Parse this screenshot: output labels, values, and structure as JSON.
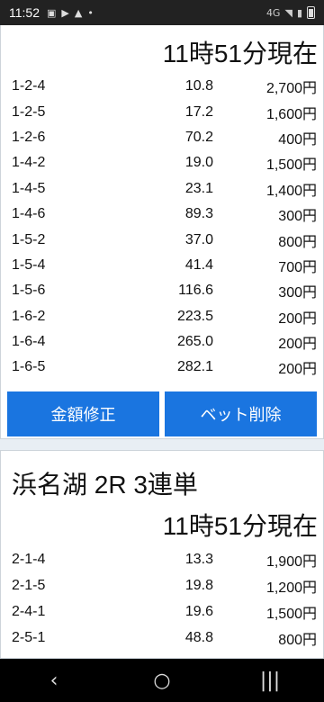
{
  "status_bar": {
    "time": "11:52",
    "icons": [
      "image-icon",
      "play-store-icon",
      "warning-icon",
      "dot-icon"
    ],
    "signal": "4G",
    "wifi_icon": "wifi-icon",
    "battery_icon": "battery-icon"
  },
  "card1": {
    "as_of": "11時51分現在",
    "rows": [
      {
        "combo": "1-2-4",
        "odds": "10.8",
        "amount": "2,700円"
      },
      {
        "combo": "1-2-5",
        "odds": "17.2",
        "amount": "1,600円"
      },
      {
        "combo": "1-2-6",
        "odds": "70.2",
        "amount": "400円"
      },
      {
        "combo": "1-4-2",
        "odds": "19.0",
        "amount": "1,500円"
      },
      {
        "combo": "1-4-5",
        "odds": "23.1",
        "amount": "1,400円"
      },
      {
        "combo": "1-4-6",
        "odds": "89.3",
        "amount": "300円"
      },
      {
        "combo": "1-5-2",
        "odds": "37.0",
        "amount": "800円"
      },
      {
        "combo": "1-5-4",
        "odds": "41.4",
        "amount": "700円"
      },
      {
        "combo": "1-5-6",
        "odds": "116.6",
        "amount": "300円"
      },
      {
        "combo": "1-6-2",
        "odds": "223.5",
        "amount": "200円"
      },
      {
        "combo": "1-6-4",
        "odds": "265.0",
        "amount": "200円"
      },
      {
        "combo": "1-6-5",
        "odds": "282.1",
        "amount": "200円"
      }
    ],
    "edit_button": "金額修正",
    "delete_button": "ベット削除"
  },
  "card2": {
    "title": "浜名湖 2R 3連単",
    "as_of": "11時51分現在",
    "rows": [
      {
        "combo": "2-1-4",
        "odds": "13.3",
        "amount": "1,900円"
      },
      {
        "combo": "2-1-5",
        "odds": "19.8",
        "amount": "1,200円"
      },
      {
        "combo": "2-4-1",
        "odds": "19.6",
        "amount": "1,500円"
      },
      {
        "combo": "2-5-1",
        "odds": "48.8",
        "amount": "800円"
      }
    ]
  },
  "nav_bar": {
    "back_glyph": "‹",
    "home_glyph": "○",
    "recents_glyph": "|||"
  },
  "colors": {
    "button_bg": "#1a75e0",
    "status_bar_bg": "#222222",
    "nav_bar_bg": "#000000"
  }
}
